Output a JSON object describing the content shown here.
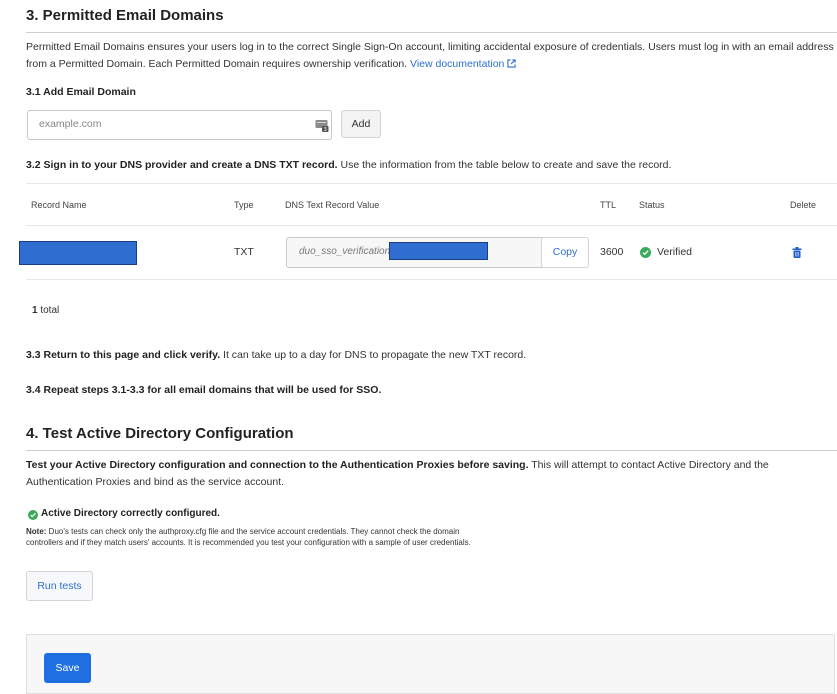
{
  "section3": {
    "title": "3. Permitted Email Domains",
    "description": "Permitted Email Domains ensures your users log in to the correct Single Sign-On account, limiting accidental exposure of credentials. Users must log in with an email address from a Permitted Domain. Each Permitted Domain requires ownership verification.",
    "doc_link": "View documentation",
    "step1_title": "3.1 Add Email Domain",
    "domain_input_placeholder": "example.com",
    "add_label": "Add",
    "step2_bold": "3.2 Sign in to your DNS provider and create a DNS TXT record.",
    "step2_rest": " Use the information from the table below to create and save the record.",
    "table": {
      "headers": [
        "Record Name",
        "Type",
        "DNS Text Record Value",
        "TTL",
        "Status",
        "Delete"
      ],
      "rows": [
        {
          "record_name": "",
          "type": "TXT",
          "value": "duo_sso_verification",
          "copy_label": "Copy",
          "ttl": "3600",
          "status": "Verified"
        }
      ]
    },
    "total_count": "1",
    "total_label": " total",
    "step3_bold": "3.3 Return to this page and click verify.",
    "step3_rest": " It can take up to a day for DNS to propagate the new TXT record.",
    "step4": "3.4 Repeat steps 3.1-3.3 for all email domains that will be used for SSO."
  },
  "section4": {
    "title": "4. Test Active Directory Configuration",
    "intro_bold": "Test your Active Directory configuration and connection to the Authentication Proxies before saving.",
    "intro_rest": " This will attempt to contact Active Directory and the Authentication Proxies and bind as the service account.",
    "result": "Active Directory correctly configured.",
    "note_label": "Note:",
    "note_text": " Duo's tests can check only the authproxy.cfg file and the service account credentials. They cannot check the domain controllers and if they match users' accounts. It is recommended you test your configuration with a sample of user credentials.",
    "run_tests_label": "Run tests"
  },
  "footer": {
    "save_label": "Save"
  },
  "colors": {
    "link": "#2e6fd1",
    "verified_green": "#3aaa5c",
    "save_blue": "#1f6fe0"
  },
  "icons": {
    "external_link": "external-link-icon",
    "input_helper": "autofill-card-icon",
    "check": "check-circle-icon",
    "delete": "trash-icon"
  }
}
